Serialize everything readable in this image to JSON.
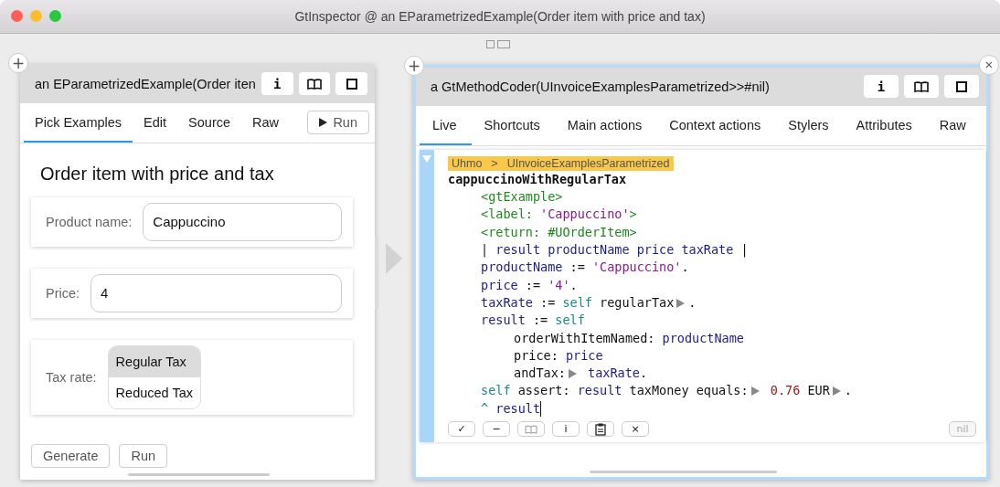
{
  "window": {
    "title": "GtInspector @ an EParametrizedExample(Order item with price and tax)"
  },
  "left_pane": {
    "add_button": "+",
    "title": "an EParametrizedExample(Order iten",
    "header_buttons": [
      {
        "kind": "text",
        "label": "i"
      },
      {
        "kind": "book"
      },
      {
        "kind": "square"
      }
    ],
    "tabs": [
      {
        "label": "Pick Examples",
        "selected": true
      },
      {
        "label": "Edit",
        "selected": false
      },
      {
        "label": "Source",
        "selected": false
      },
      {
        "label": "Raw",
        "selected": false
      }
    ],
    "run_button": "Run",
    "heading": "Order item with price and tax",
    "fields": [
      {
        "label": "Product name:",
        "value": "Cappuccino"
      },
      {
        "label": "Price:",
        "value": "4"
      }
    ],
    "tax_rate": {
      "label": "Tax rate:",
      "options": [
        {
          "label": "Regular Tax",
          "selected": true
        },
        {
          "label": "Reduced Tax",
          "selected": false
        }
      ]
    },
    "buttons": [
      "Generate",
      "Run"
    ]
  },
  "right_pane": {
    "add_button": "+",
    "close_button": "×",
    "title": "a GtMethodCoder(UInvoiceExamplesParametrized>>#nil)",
    "header_buttons": [
      {
        "kind": "text",
        "label": "i"
      },
      {
        "kind": "book"
      },
      {
        "kind": "square"
      }
    ],
    "tabs": [
      {
        "label": "Live",
        "selected": true
      },
      {
        "label": "Shortcuts",
        "selected": false
      },
      {
        "label": "Main actions",
        "selected": false
      },
      {
        "label": "Context actions",
        "selected": false
      },
      {
        "label": "Stylers",
        "selected": false
      },
      {
        "label": "Attributes",
        "selected": false
      },
      {
        "label": "Raw",
        "selected": false
      }
    ],
    "breadcrumb": [
      "Uhmo",
      ">",
      "UInvoiceExamplesParametrized"
    ],
    "method_name": "cappuccinoWithRegularTax",
    "code": [
      {
        "tokens": [
          {
            "kind": "pragma",
            "text": "<gtExample>"
          }
        ]
      },
      {
        "tokens": [
          {
            "kind": "pragma",
            "text": "<label: "
          },
          {
            "kind": "string",
            "text": "'Cappuccino'"
          },
          {
            "kind": "pragma",
            "text": ">"
          }
        ]
      },
      {
        "tokens": [
          {
            "kind": "pragma",
            "text": "<return: #UOrderItem>"
          }
        ]
      },
      {
        "tokens": [
          {
            "kind": "plain",
            "text": "| "
          },
          {
            "kind": "var",
            "text": "result productName price taxRate"
          },
          {
            "kind": "plain",
            "text": " |"
          }
        ]
      },
      {
        "tokens": [
          {
            "kind": "var",
            "text": "productName"
          },
          {
            "kind": "plain",
            "text": " := "
          },
          {
            "kind": "string",
            "text": "'Cappuccino'"
          },
          {
            "kind": "plain",
            "text": "."
          }
        ]
      },
      {
        "tokens": [
          {
            "kind": "var",
            "text": "price"
          },
          {
            "kind": "plain",
            "text": " := "
          },
          {
            "kind": "string",
            "text": "'4'"
          },
          {
            "kind": "plain",
            "text": "."
          }
        ]
      },
      {
        "tokens": [
          {
            "kind": "var",
            "text": "taxRate"
          },
          {
            "kind": "plain",
            "text": " := "
          },
          {
            "kind": "self",
            "text": "self"
          },
          {
            "kind": "plain",
            "text": " regularTax"
          },
          {
            "kind": "expander"
          },
          {
            "kind": "plain",
            "text": "."
          }
        ]
      },
      {
        "tokens": [
          {
            "kind": "var",
            "text": "result"
          },
          {
            "kind": "plain",
            "text": " := "
          },
          {
            "kind": "self",
            "text": "self"
          }
        ],
        "children": [
          {
            "tokens": [
              {
                "kind": "plain",
                "text": "orderWithItemNamed: "
              },
              {
                "kind": "var",
                "text": "productName"
              }
            ]
          },
          {
            "tokens": [
              {
                "kind": "plain",
                "text": "price: "
              },
              {
                "kind": "var",
                "text": "price"
              }
            ]
          },
          {
            "tokens": [
              {
                "kind": "plain",
                "text": "andTax:"
              },
              {
                "kind": "expander"
              },
              {
                "kind": "var",
                "text": " taxRate"
              },
              {
                "kind": "plain",
                "text": "."
              }
            ]
          }
        ]
      },
      {
        "tokens": [
          {
            "kind": "self",
            "text": "self"
          },
          {
            "kind": "plain",
            "text": " assert: "
          },
          {
            "kind": "var",
            "text": "result"
          },
          {
            "kind": "plain",
            "text": " taxMoney equals:"
          },
          {
            "kind": "expander"
          },
          {
            "kind": "number",
            "text": " 0.76"
          },
          {
            "kind": "plain",
            "text": " EUR"
          },
          {
            "kind": "expander"
          },
          {
            "kind": "plain",
            "text": "."
          }
        ]
      },
      {
        "tokens": [
          {
            "kind": "self",
            "text": "^"
          },
          {
            "kind": "var",
            "text": " result",
            "cursor": true
          }
        ]
      }
    ],
    "toolbar": [
      {
        "kind": "text",
        "label": "✓"
      },
      {
        "kind": "text",
        "label": "−"
      },
      {
        "kind": "book"
      },
      {
        "kind": "text",
        "label": "i"
      },
      {
        "kind": "clipboard"
      },
      {
        "kind": "text",
        "label": "×"
      }
    ],
    "result_button": {
      "label": "nil",
      "disabled": true
    }
  }
}
